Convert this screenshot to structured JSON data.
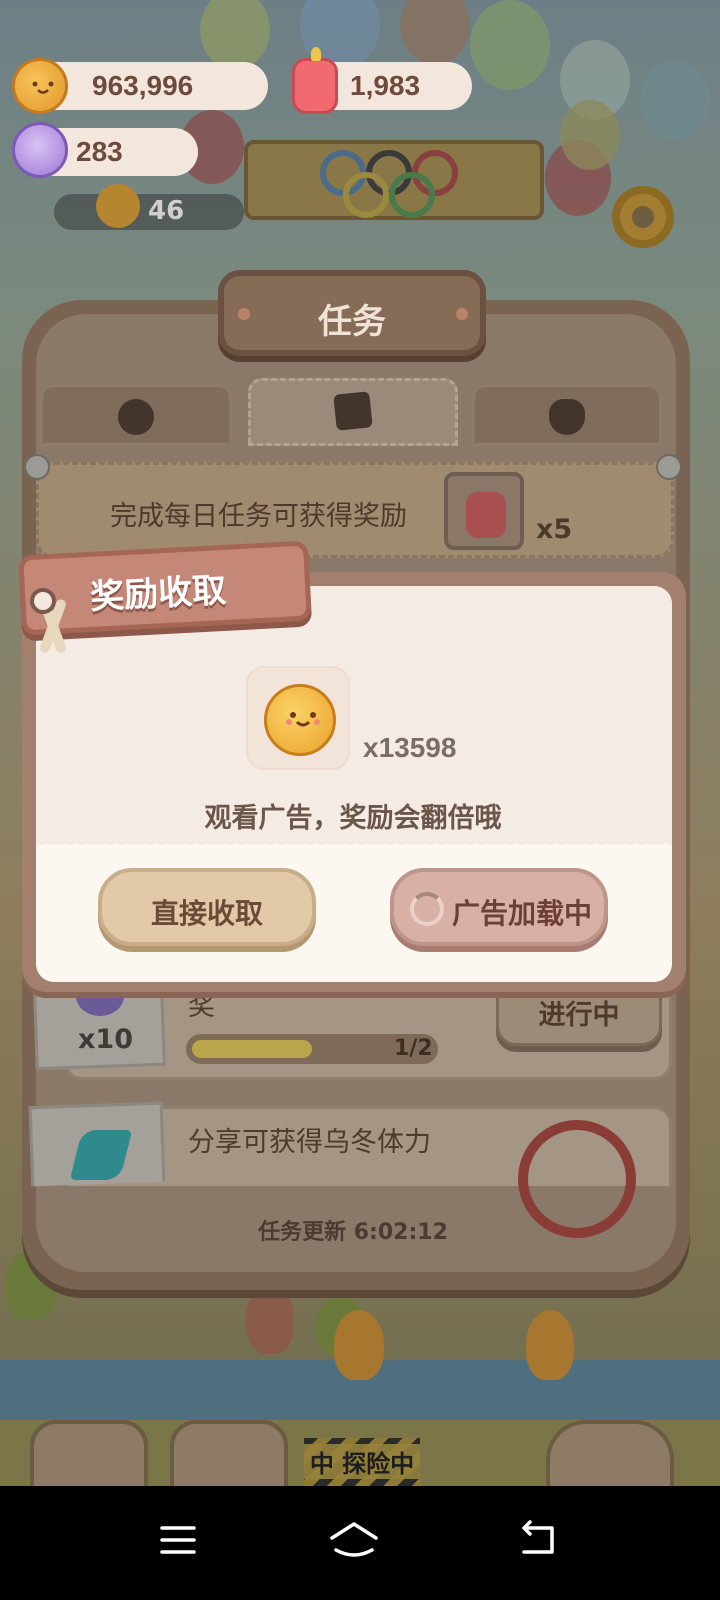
{
  "currencies": {
    "cookies": "963,996",
    "candles": "1,983",
    "gems": "283"
  },
  "scene": {
    "level": "46",
    "explore_label": "中 探险中"
  },
  "panel": {
    "title": "任务",
    "tabs": [
      {
        "icon": "paw-badge-icon"
      },
      {
        "icon": "task-sheet-icon"
      },
      {
        "icon": "bear-heart-icon"
      }
    ],
    "daily_banner": {
      "text": "完成每日任务可获得奖励",
      "reward_qty": "x5",
      "reward_icon": "candle-icon"
    },
    "tasks": [
      {
        "partial_title": "奖",
        "reward_qty": "x10",
        "progress_text": "1/2",
        "progress": 0.5,
        "button": "进行中"
      },
      {
        "title": "分享可获得乌冬体力"
      }
    ],
    "refresh": "任务更新 6:02:12"
  },
  "dialog": {
    "title": "奖励收取",
    "reward_icon": "cookie-icon",
    "reward_qty": "x13598",
    "hint": "观看广告，奖励会翻倍哦",
    "direct_button": "直接收取",
    "ad_button": "广告加载中"
  },
  "colors": {
    "dialog_bg": "#fdf7f2",
    "ribbon": "#c58778",
    "direct_button": "#e2caa8",
    "ad_button": "#d8b0a6"
  }
}
